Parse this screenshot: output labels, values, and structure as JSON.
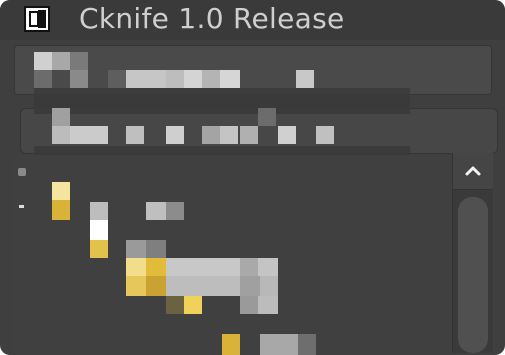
{
  "window": {
    "title": "Cknife 1.0 Release",
    "icon": "app-window-icon"
  },
  "toolbar": {
    "label": "toolbar"
  },
  "address_bar": {
    "label": "address bar"
  },
  "scrollbar": {
    "up_icon": "chevron-up-icon"
  },
  "colors": {
    "background": "#3f3f3f",
    "title_text": "#cfcfcf",
    "folder_gold": "#d8b338",
    "pixel_gray": "#bfbfbf"
  }
}
